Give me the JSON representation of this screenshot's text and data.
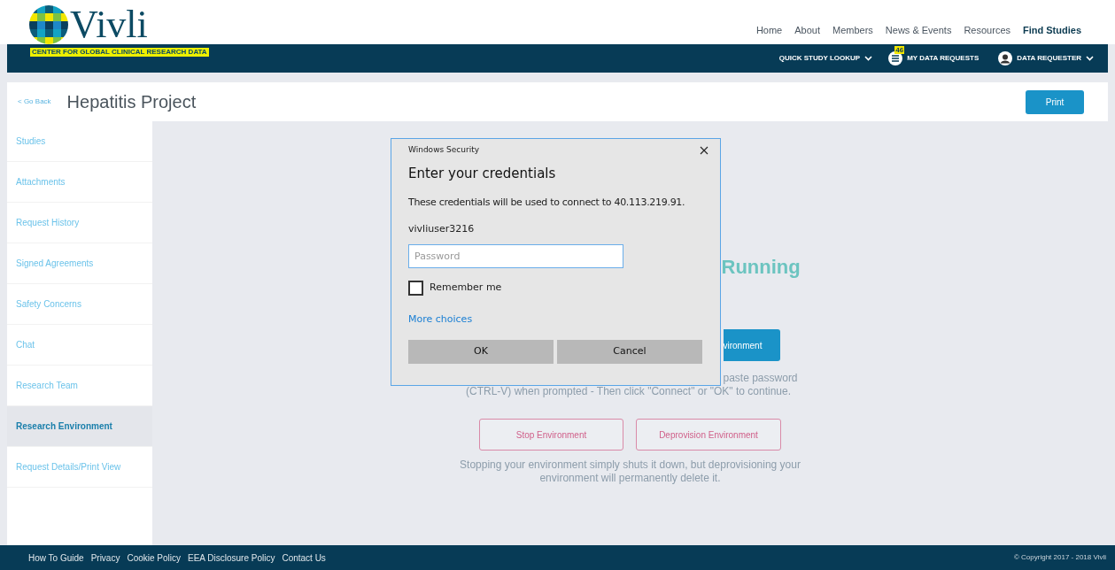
{
  "logo": {
    "name": "Vivli",
    "tagline": "CENTER FOR GLOBAL CLINICAL RESEARCH DATA"
  },
  "top_nav": [
    {
      "label": "Home",
      "selected": false
    },
    {
      "label": "About",
      "selected": false
    },
    {
      "label": "Members",
      "selected": false
    },
    {
      "label": "News & Events",
      "selected": false
    },
    {
      "label": "Resources",
      "selected": false
    },
    {
      "label": "Find Studies",
      "selected": true
    }
  ],
  "sub_nav": [
    {
      "kind": "dropdown",
      "label": "QUICK STUDY LOOKUP"
    },
    {
      "kind": "requests",
      "label": "MY DATA REQUESTS",
      "badge": "46"
    },
    {
      "kind": "user",
      "label": "DATA REQUESTER"
    }
  ],
  "page_header": {
    "back": "< Go Back",
    "title": "Hepatitis Project",
    "print": "Print"
  },
  "sidebar": [
    {
      "label": "Studies",
      "selected": false
    },
    {
      "label": "Attachments",
      "selected": false
    },
    {
      "label": "Request History",
      "selected": false
    },
    {
      "label": "Signed Agreements",
      "selected": false
    },
    {
      "label": "Safety Concerns",
      "selected": false
    },
    {
      "label": "Chat",
      "selected": false
    },
    {
      "label": "Research Team",
      "selected": false
    },
    {
      "label": "Research Environment",
      "selected": true
    },
    {
      "label": "Request Details/Print View",
      "selected": false
    }
  ],
  "main": {
    "status_fragment": "Running",
    "start_button_fragment": "vironment",
    "help_fragment_1": "paste password",
    "help_line_2": "(CTRL-V) when prompted - Then click \"Connect\" or \"OK\" to continue.",
    "stop_button": "Stop Environment",
    "deprovision_button": "Deprovision Environment",
    "note": "Stopping your environment simply shuts it down, but deprovisioning your environment will permanently delete it."
  },
  "dialog": {
    "window_title": "Windows Security",
    "heading": "Enter your credentials",
    "message": "These credentials will be used to connect to 40.113.219.91.",
    "username": "vivliuser3216",
    "password_placeholder": "Password",
    "remember": {
      "label": "Remember me",
      "checked": false
    },
    "more_choices": "More choices",
    "ok": "OK",
    "cancel": "Cancel"
  },
  "footer": {
    "links": [
      "How To Guide",
      "Privacy",
      "Cookie Policy",
      "EEA Disclosure Policy",
      "Contact Us"
    ],
    "copyright": "© Copyright 2017 - 2018 Vivli"
  }
}
